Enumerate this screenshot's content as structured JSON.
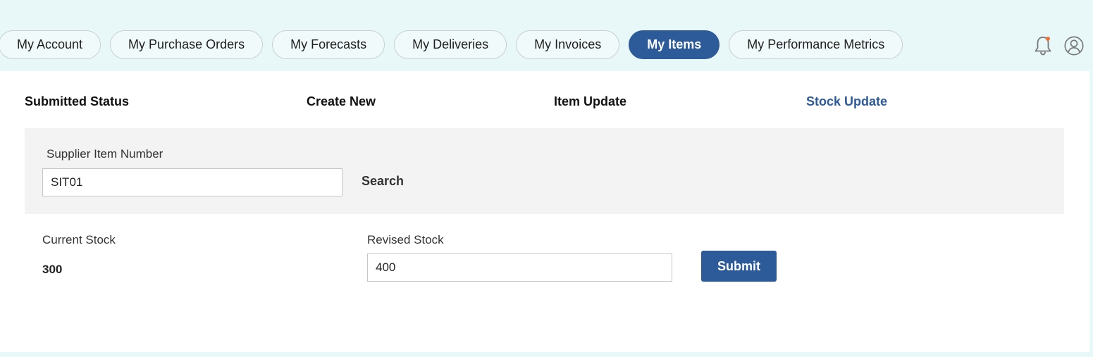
{
  "nav": {
    "tabs": [
      {
        "label": "My Account",
        "active": false
      },
      {
        "label": "My Purchase Orders",
        "active": false
      },
      {
        "label": "My Forecasts",
        "active": false
      },
      {
        "label": "My Deliveries",
        "active": false
      },
      {
        "label": "My Invoices",
        "active": false
      },
      {
        "label": "My Items",
        "active": true
      },
      {
        "label": "My Performance Metrics",
        "active": false
      }
    ],
    "icons": [
      "bell-icon",
      "user-account-icon"
    ],
    "notification_dot_color": "#e8743b"
  },
  "subnav": {
    "items": [
      {
        "label": "Submitted Status",
        "active": false
      },
      {
        "label": "Create New",
        "active": false
      },
      {
        "label": "Item Update",
        "active": false
      },
      {
        "label": "Stock Update",
        "active": true
      }
    ]
  },
  "search": {
    "label": "Supplier Item Number",
    "value": "SIT01",
    "button_label": "Search"
  },
  "stock": {
    "current_label": "Current Stock",
    "current_value": "300",
    "revised_label": "Revised Stock",
    "revised_value": "400",
    "submit_label": "Submit"
  },
  "colors": {
    "accent": "#2d5b9a",
    "background": "#e8f8f8",
    "panel": "#ffffff",
    "search_panel": "#f3f3f3"
  }
}
